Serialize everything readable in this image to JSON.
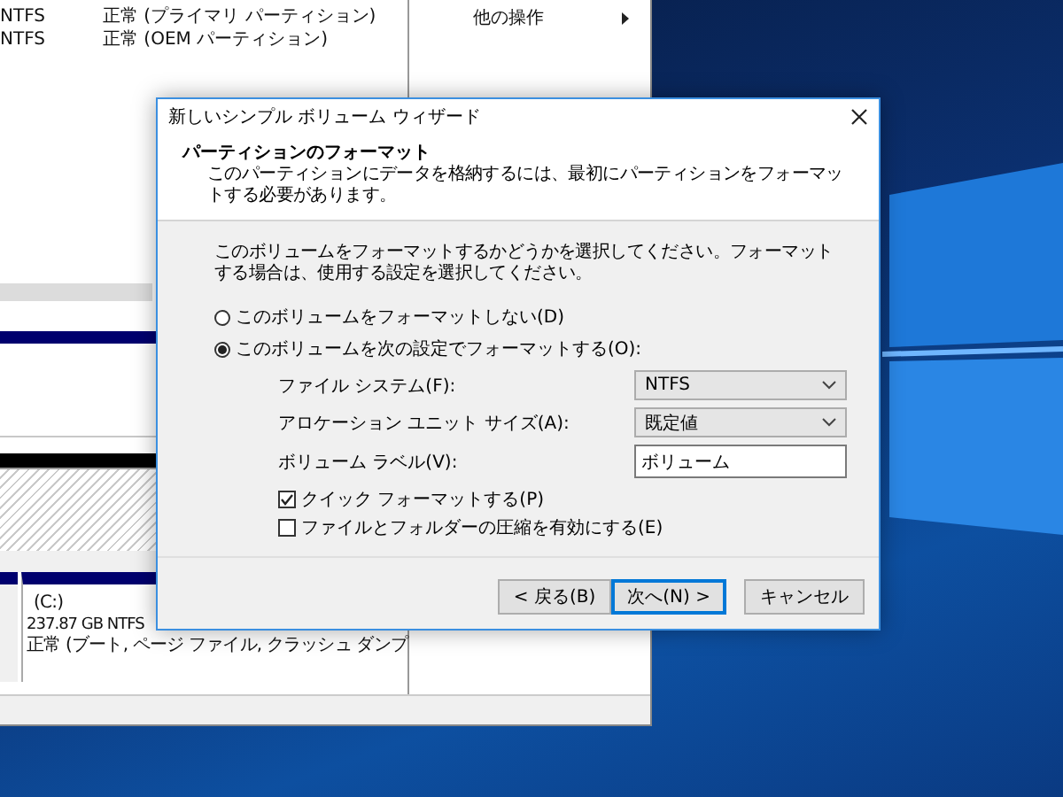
{
  "disk_window": {
    "volumes": [
      {
        "file_system": "NTFS",
        "status": "正常 (プライマリ パーティション)"
      },
      {
        "file_system": "NTFS",
        "status": "正常 (OEM パーティション)"
      }
    ],
    "actions": [
      {
        "label": "他の操作",
        "has_submenu": true
      }
    ],
    "partition": {
      "name": "(C:)",
      "size": "237.87 GB NTFS",
      "status": "正常 (ブート, ページ ファイル, クラッシュ ダンプ"
    }
  },
  "dialog": {
    "title": "新しいシンプル ボリューム ウィザード",
    "header": {
      "title": "パーティションのフォーマット",
      "subtitle": "このパーティションにデータを格納するには、最初にパーティションをフォーマットする必要があります。"
    },
    "description": "このボリュームをフォーマットするかどうかを選択してください。フォーマットする場合は、使用する設定を選択してください。",
    "options": [
      {
        "label": "このボリュームをフォーマットしない(D)",
        "selected": false
      },
      {
        "label": "このボリュームを次の設定でフォーマットする(O):",
        "selected": true
      }
    ],
    "settings": [
      {
        "kind": "select",
        "label": "ファイル システム(F):",
        "value": "NTFS"
      },
      {
        "kind": "select",
        "label": "アロケーション ユニット サイズ(A):",
        "value": "既定値"
      },
      {
        "kind": "text",
        "label": "ボリューム ラベル(V):",
        "value": "ボリューム"
      }
    ],
    "checkboxes": [
      {
        "label": "クイック フォーマットする(P)",
        "checked": true
      },
      {
        "label": "ファイルとフォルダーの圧縮を有効にする(E)",
        "checked": false
      }
    ],
    "buttons": [
      {
        "label": "< 戻る(B)",
        "default": false
      },
      {
        "label": "次へ(N) >",
        "default": true
      },
      {
        "label": "キャンセル",
        "default": false
      }
    ]
  }
}
